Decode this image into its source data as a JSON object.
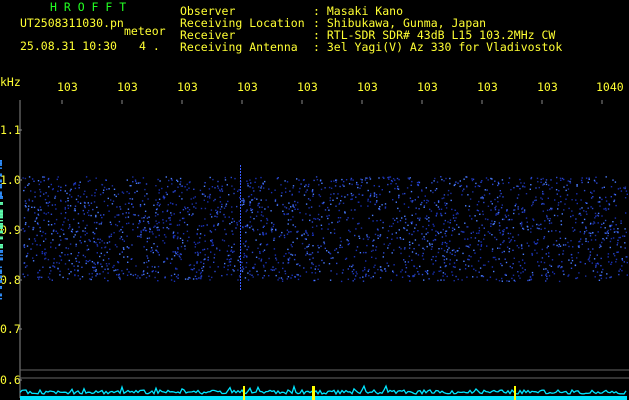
{
  "app": {
    "title": "H R O F F T",
    "filename": "UT2508311030.pn",
    "type_label": "meteor",
    "datetime": "25.08.31 10:30",
    "count": "4 ."
  },
  "info": {
    "rows": [
      {
        "key": "Observer",
        "value": ": Masaki Kano"
      },
      {
        "key": "Receiving Location",
        "value": ": Shibukawa, Gunma, Japan"
      },
      {
        "key": "Receiver",
        "value": ": RTL-SDR SDR# 43dB L15 103.2MHz CW"
      },
      {
        "key": "Receiving Antenna",
        "value": ": 3el Yagi(V) Az 330 for Vladivostok"
      }
    ]
  },
  "axis": {
    "unit": "kHz",
    "x_ticks": [
      "103",
      "103",
      "103",
      "103",
      "103",
      "103",
      "103",
      "103",
      "103",
      "1040"
    ],
    "y_ticks": [
      "1.1",
      "1.0",
      "0.9",
      "0.8",
      "0.7",
      "0.6"
    ]
  },
  "colors": {
    "text": "#ffff33",
    "title": "#22ff22",
    "signal": "#00e5ff",
    "noise_low": "#1a2fa0",
    "noise_high": "#4a7cff",
    "marker": "#ffff00"
  }
}
